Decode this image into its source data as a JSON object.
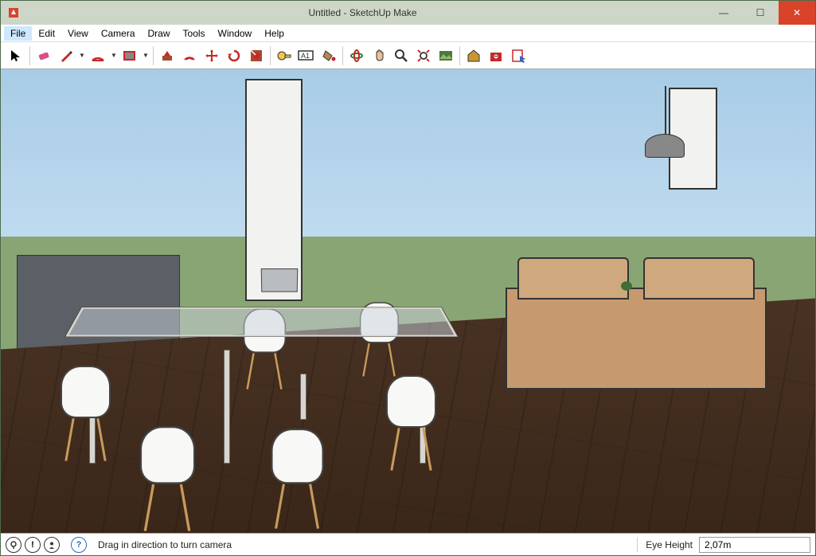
{
  "window": {
    "title": "Untitled - SketchUp Make",
    "controls": {
      "min": "—",
      "max": "☐",
      "close": "✕"
    }
  },
  "menubar": {
    "items": [
      "File",
      "Edit",
      "View",
      "Camera",
      "Draw",
      "Tools",
      "Window",
      "Help"
    ],
    "highlighted_index": 0
  },
  "toolbar": {
    "icons": {
      "select": "select-arrow-icon",
      "eraser": "eraser-icon",
      "pencil": "pencil-icon",
      "arc": "arc-icon",
      "rectangle": "rectangle-icon",
      "pushpull": "pushpull-icon",
      "offset": "offset-icon",
      "move": "move-icon",
      "rotate": "rotate-icon",
      "scale": "scale-icon",
      "tape": "tape-measure-icon",
      "text": "text-label-icon",
      "paint": "paint-bucket-icon",
      "orbit": "orbit-icon",
      "pan": "pan-hand-icon",
      "zoom": "zoom-icon",
      "zoom_extents": "zoom-extents-icon",
      "photo": "photo-textures-icon",
      "warehouse": "warehouse-icon",
      "extension": "extension-warehouse-icon",
      "layout": "send-to-layout-icon"
    },
    "text_label": "A1"
  },
  "statusbar": {
    "hint": "Drag in direction to turn camera",
    "eye_label": "Eye Height",
    "eye_value": "2,07m",
    "icons": [
      "geo-pin-icon",
      "info-icon",
      "user-icon",
      "help-icon"
    ]
  }
}
